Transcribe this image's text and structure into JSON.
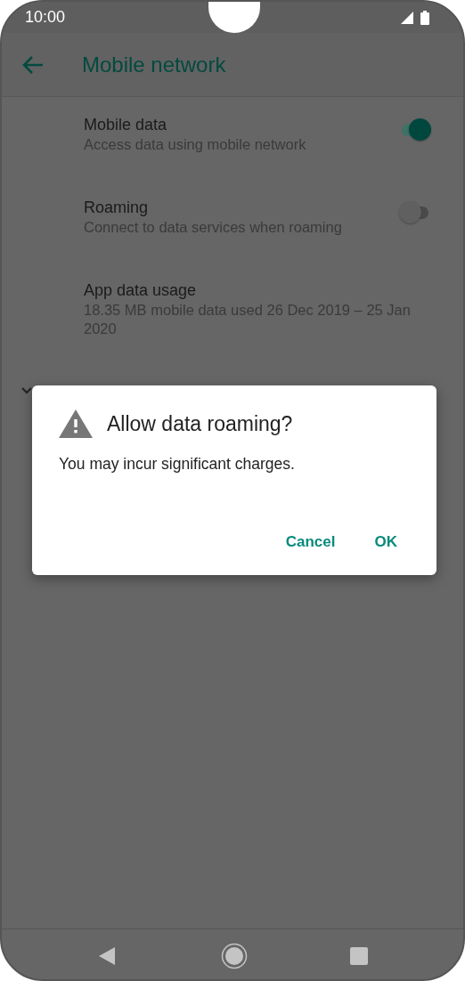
{
  "status_bar": {
    "time": "10:00"
  },
  "app_bar": {
    "title": "Mobile network"
  },
  "settings": [
    {
      "kind": "toggle",
      "title": "Mobile data",
      "summary": "Access data using mobile network",
      "on": true
    },
    {
      "kind": "toggle",
      "title": "Roaming",
      "summary": "Connect to data services when roaming",
      "on": false
    },
    {
      "kind": "plain",
      "title": "App data usage",
      "summary": "18.35 MB mobile data used 26 Dec 2019 – 25 Jan 2020"
    }
  ],
  "dialog": {
    "title": "Allow data roaming?",
    "message": "You may incur significant charges.",
    "buttons": [
      "Cancel",
      "OK"
    ]
  }
}
